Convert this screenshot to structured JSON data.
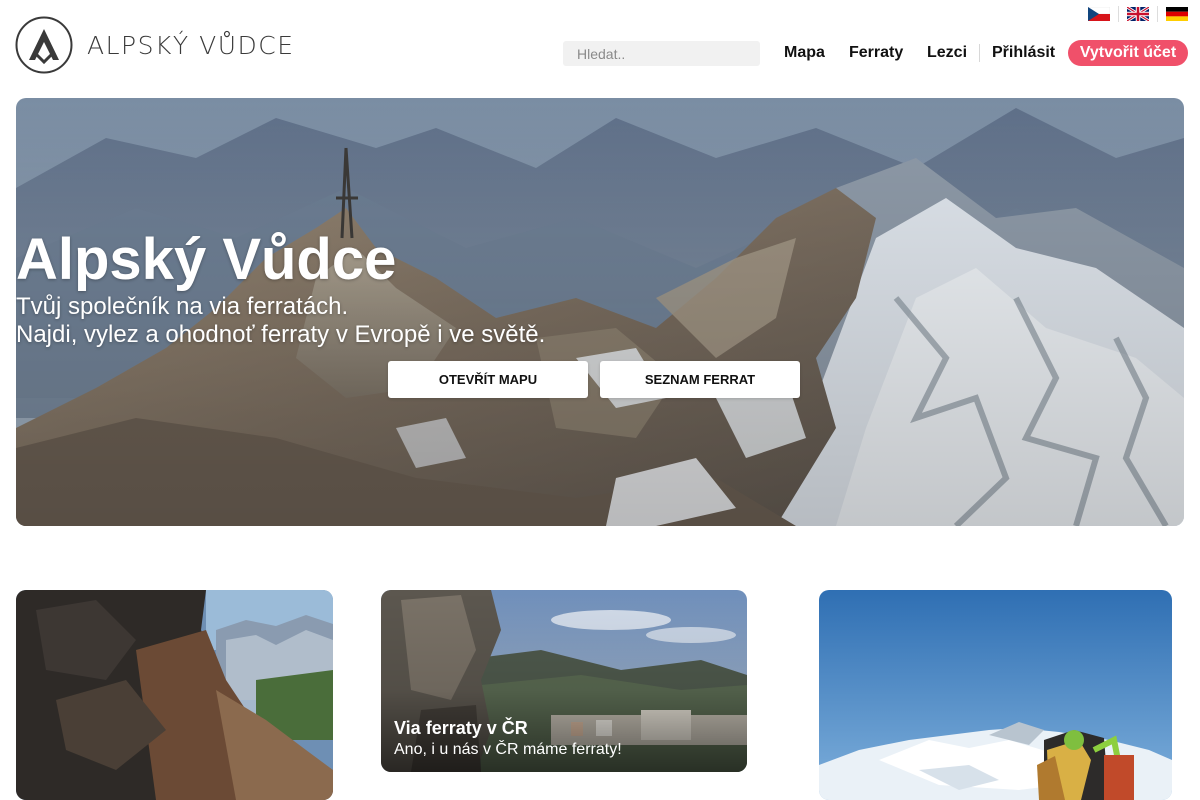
{
  "brand": {
    "name": "ALPSKÝ VŮDCE"
  },
  "languages": [
    {
      "code": "cs",
      "icon": "czech-flag-icon"
    },
    {
      "code": "en",
      "icon": "uk-flag-icon"
    },
    {
      "code": "de",
      "icon": "german-flag-icon"
    }
  ],
  "search": {
    "placeholder": "Hledat.."
  },
  "nav": {
    "map": "Mapa",
    "ferratas": "Ferraty",
    "climbers": "Lezci",
    "login": "Přihlásit",
    "register": "Vytvořit účet"
  },
  "hero": {
    "title": "Alpský Vůdce",
    "subtitle_line1": "Tvůj společník na via ferratách.",
    "subtitle_line2": "Najdi, vylez a ohodnoť ferraty v Evropě i ve světě.",
    "button_map": "OTEVŘÍT MAPU",
    "button_list": "SEZNAM FERRAT"
  },
  "cards": [
    {
      "title": "",
      "subtitle": ""
    },
    {
      "title": "Via ferraty v ČR",
      "subtitle": "Ano, i u nás v ČR máme ferraty!"
    },
    {
      "title": "",
      "subtitle": ""
    }
  ],
  "colors": {
    "accent": "#f0506a",
    "text": "#111111",
    "search_bg": "#f1f1f1"
  }
}
